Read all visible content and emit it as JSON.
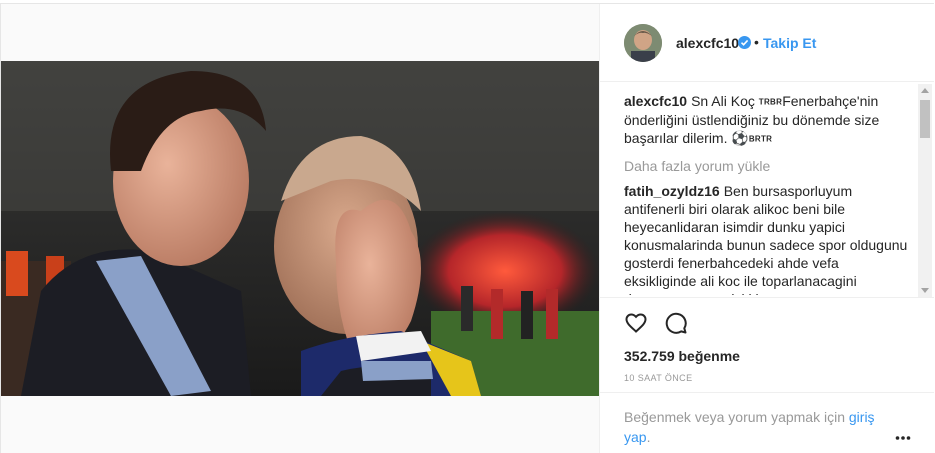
{
  "post": {
    "username": "alexcfc10",
    "verified": true,
    "separator": "•",
    "follow_label": "Takip Et"
  },
  "caption": {
    "username": "alexcfc10",
    "text_before": "Sn Ali Koç",
    "tag1": "TRBR",
    "text_after": "Fenerbahçe'nin önderliğini üstlendiğiniz bu dönemde size başarılar dilerim.",
    "emoji": "⚽",
    "tag2": "BRTR"
  },
  "load_more_label": "Daha fazla yorum yükle",
  "comment": {
    "username": "fatih_ozyldz16",
    "text": "Ben bursasporluyum antifenerli biri olarak alikoc beni bile heyecanlidaran isimdir dunku yapici konusmalarinda bunun sadece spor oldugunu gosterdi fenerbahcedeki ahde vefa eksikliginde ali koc ile toparlanacagini dusunuyorum ve iyi ki"
  },
  "likes": "352.759 beğenme",
  "timestamp": "10 SAAT ÖNCE",
  "login_prompt": {
    "text": "Beğenmek veya yorum yapmak için",
    "link": "giriş yap",
    "suffix": "."
  },
  "icons": {
    "like": "heart-icon",
    "comment": "comment-bubble-icon",
    "more": "more-options-icon",
    "verified": "verified-badge-icon"
  },
  "colors": {
    "link_blue": "#3897f0",
    "text": "#262626",
    "muted": "#999999"
  }
}
